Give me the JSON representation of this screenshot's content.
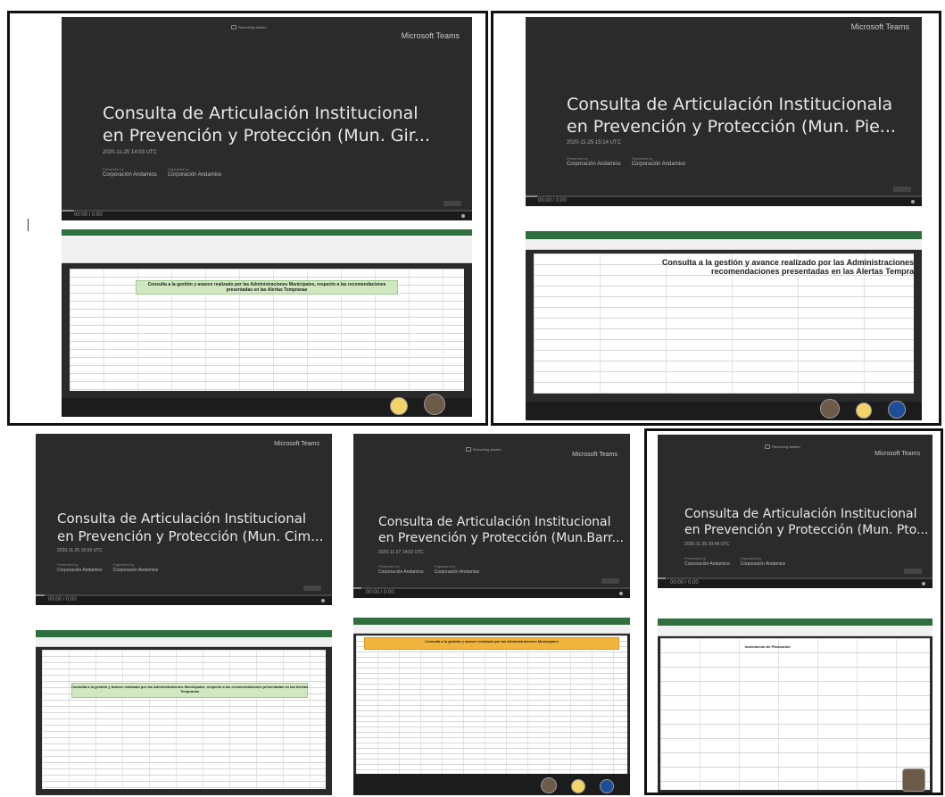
{
  "app": "Microsoft Teams",
  "recording_notice": "Recording started",
  "labels": {
    "presenter": "Presented by",
    "organizer": "Organized by"
  },
  "meetings": [
    {
      "title_line1": "Consulta de Articulación Institucional",
      "title_line2": "en Prevención y Protección (Mun. Gir...",
      "date": "2020-11-25 14:03 UTC",
      "presenter": "Corporación Andamios",
      "organizer": "Corporación Andamios",
      "time": "00:00 / 0:00"
    },
    {
      "title_line1": "Consulta de Articulación Institucionala",
      "title_line2": "en Prevención y Protección (Mun. Pie...",
      "date": "2020-11-25 15:14 UTC",
      "presenter": "Corporación Andamios",
      "organizer": "Corporación Andamios",
      "time": "00:00 / 0:00"
    },
    {
      "title_line1": "Consulta de Articulación Institucional",
      "title_line2": "en Prevención y Protección (Mun. Cim...",
      "date": "2020-11-25 16:06 UTC",
      "presenter": "Corporación Andamios",
      "organizer": "Corporación Andamios",
      "time": "00:00 / 0:00"
    },
    {
      "title_line1": "Consulta de Articulación Institucional",
      "title_line2": "en Prevención y Protección (Mun.Barr...",
      "date": "2020-11-27 14:02 UTC",
      "presenter": "Corporación Andamios",
      "organizer": "Corporación Andamios",
      "time": "00:00 / 0:00"
    },
    {
      "title_line1": "Consulta de Articulación Institucional",
      "title_line2": "en Prevención y Protección (Mun. Pto...",
      "date": "2020-11-26 20:48 UTC",
      "presenter": "Corporación Andamios",
      "organizer": "Corporación Andamios",
      "time": "00:00 / 0:00"
    }
  ],
  "sheets": [
    {
      "header": "Consulta a la gestión y avance realizado por las Administraciones Municipales, respecto a las recomendaciones presentadas en las Alertas Tempranas"
    },
    {
      "header": "Consulta a la gestión y avance realizado por las Administraciones recomendaciones presentadas en las Alertas Tempra"
    },
    {
      "header": "Consulta a la gestión y avance realizado por las Administraciones Municipales, respecto a las recomendaciones presentadas en las Alertas Tempranas"
    },
    {
      "header": "Consulta a la gestión y avance realizado por las Administraciones Municipales"
    },
    {
      "header": "Instrumento de Planeación"
    }
  ]
}
